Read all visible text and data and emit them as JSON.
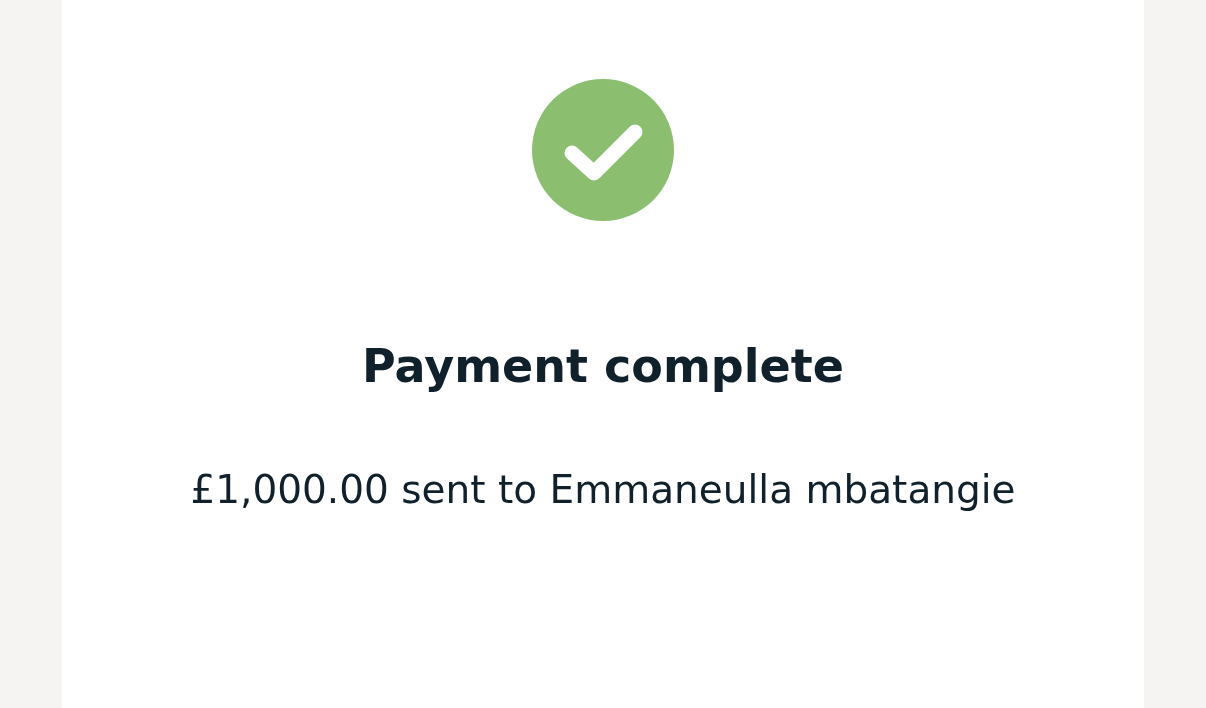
{
  "status": {
    "kind": "success"
  },
  "title": "Payment complete",
  "message": "£1,000.00 sent to Emmaneulla mbatangie"
}
